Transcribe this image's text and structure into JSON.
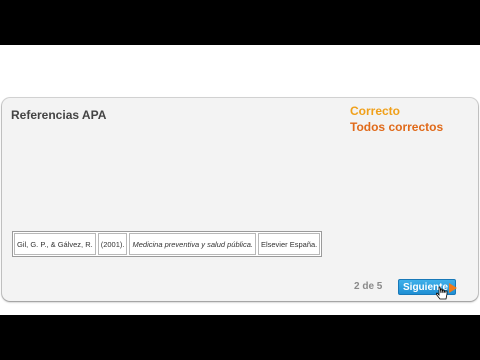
{
  "header": {
    "title": "Referencias APA"
  },
  "status": {
    "correct": "Correcto",
    "all_correct": "Todos correctos"
  },
  "references": [
    {
      "text": "Gil, G. P., & Gálvez, R.",
      "italic": false
    },
    {
      "text": "(2001).",
      "italic": false
    },
    {
      "text": "Medicina preventiva y salud pública.",
      "italic": true
    },
    {
      "text": "Elsevier España.",
      "italic": false
    }
  ],
  "pager": {
    "text": "2 de 5"
  },
  "next_button": {
    "label": "Siguiente"
  },
  "colors": {
    "correct": "#f0a01a",
    "all_correct": "#e06a1a",
    "button": "#1f8fd4"
  }
}
